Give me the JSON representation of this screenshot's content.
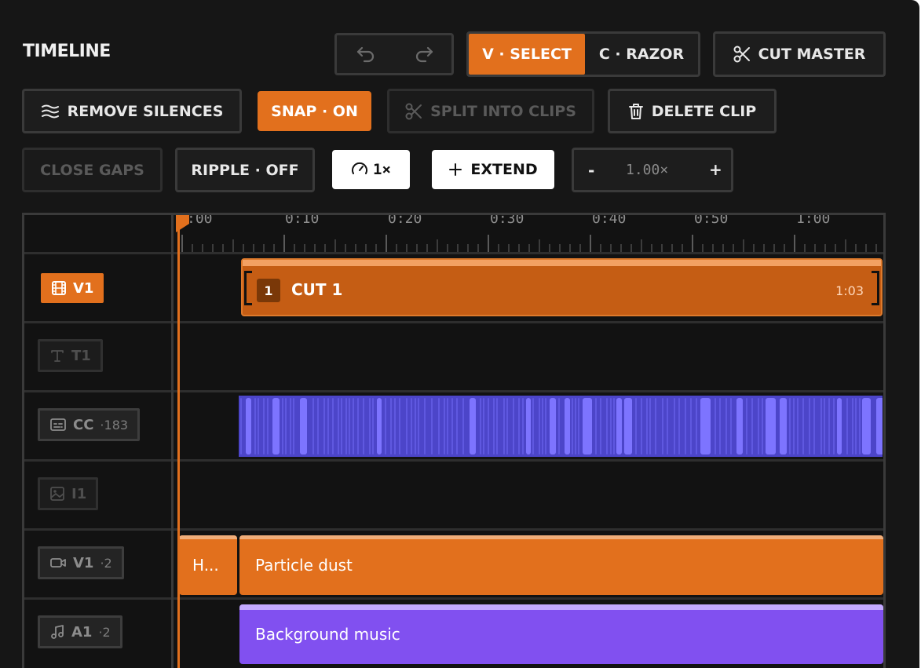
{
  "panel": {
    "title": "TIMELINE"
  },
  "toolbar": {
    "undo_icon": "undo-icon",
    "redo_icon": "redo-icon",
    "select_label": "V · SELECT",
    "razor_label": "C · RAZOR",
    "cut_master_label": "CUT MASTER",
    "remove_silences_label": "REMOVE SILENCES",
    "snap_label": "SNAP · ON",
    "split_label": "SPLIT INTO CLIPS",
    "delete_label": "DELETE CLIP",
    "close_gaps_label": "CLOSE GAPS",
    "ripple_label": "RIPPLE · OFF",
    "speed_label": "1×",
    "extend_label": "EXTEND",
    "zoom_minus": "-",
    "zoom_value": "1.00×",
    "zoom_plus": "+"
  },
  "ruler": {
    "labels": [
      ":00",
      "0:10",
      "0:20",
      "0:30",
      "0:40",
      "0:50",
      "1:00"
    ]
  },
  "tracks": [
    {
      "label": "V1",
      "sub": "",
      "icon": "film-icon",
      "state": "active"
    },
    {
      "label": "T1",
      "sub": "",
      "icon": "text-icon",
      "state": "dim"
    },
    {
      "label": "CC",
      "sub": "·183",
      "icon": "captions-icon",
      "state": "normal"
    },
    {
      "label": "I1",
      "sub": "",
      "icon": "image-icon",
      "state": "dim"
    },
    {
      "label": "V1",
      "sub": "·2",
      "icon": "video-icon",
      "state": "normal"
    },
    {
      "label": "A1",
      "sub": "·2",
      "icon": "music-icon",
      "state": "normal"
    }
  ],
  "clips": {
    "cut": {
      "index": "1",
      "name": "CUT 1",
      "duration": "1:03"
    },
    "short_clip": "H...",
    "particle": "Particle dust",
    "music": "Background music"
  },
  "colors": {
    "accent": "#e2701d",
    "caption": "#4c45c9",
    "music": "#8150f0"
  }
}
